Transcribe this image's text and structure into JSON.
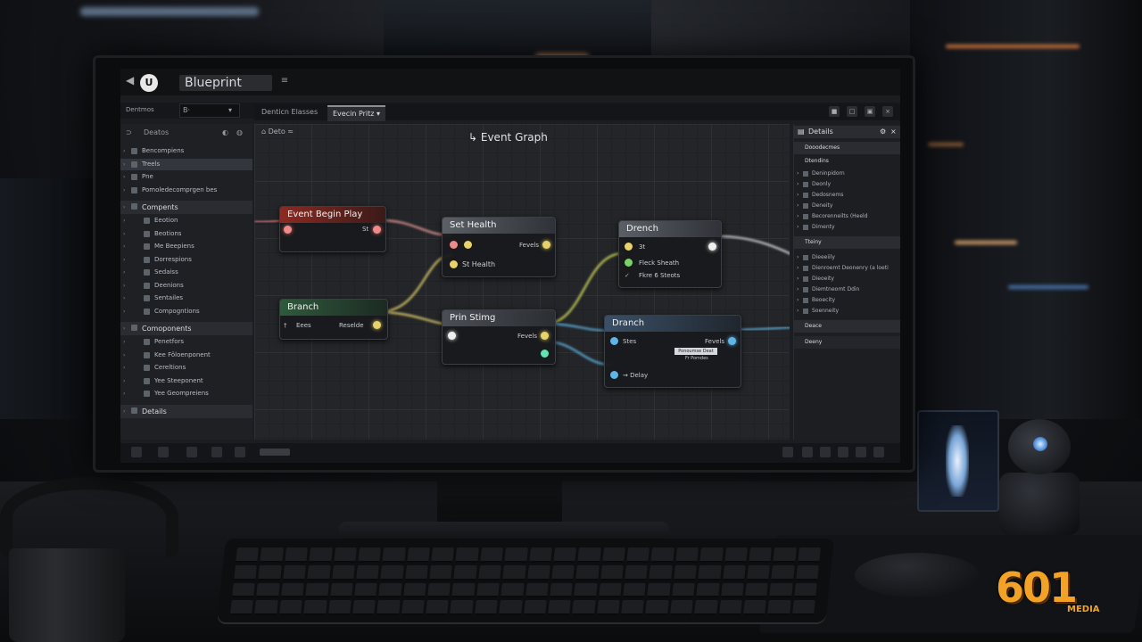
{
  "window": {
    "title": "Blueprint",
    "menu": [
      "Dentmos",
      "B·"
    ],
    "tabs": [
      "Denticn Elasses",
      "Evecin Pritz"
    ],
    "search": "Deatos"
  },
  "left_panel": {
    "sections": [
      {
        "label": "Bencompiens",
        "kind": "row"
      },
      {
        "label": "Treels",
        "kind": "highlight"
      },
      {
        "label": "Pne",
        "kind": "row"
      },
      {
        "label": "Pomoledecomprgen bes",
        "kind": "row"
      },
      {
        "label": "Compents",
        "kind": "header"
      },
      {
        "label": "Eeotion",
        "kind": "sub"
      },
      {
        "label": "Beotions",
        "kind": "sub"
      },
      {
        "label": "Me Beepiens",
        "kind": "sub"
      },
      {
        "label": "Dorrespions",
        "kind": "sub"
      },
      {
        "label": "Sedaiss",
        "kind": "sub"
      },
      {
        "label": "Deenions",
        "kind": "sub"
      },
      {
        "label": "Sentailes",
        "kind": "sub"
      },
      {
        "label": "Compogntions",
        "kind": "sub"
      },
      {
        "label": "Comoponents",
        "kind": "header"
      },
      {
        "label": "Penetfors",
        "kind": "sub"
      },
      {
        "label": "Kee Föloenponent",
        "kind": "sub"
      },
      {
        "label": "Cereltions",
        "kind": "sub"
      },
      {
        "label": "Yee Steeponent",
        "kind": "sub"
      },
      {
        "label": "Yee Geompreiens",
        "kind": "sub"
      },
      {
        "label": "Details",
        "kind": "header"
      }
    ]
  },
  "graph": {
    "title": "Event Graph",
    "crumb": "Deto",
    "nodes": {
      "begin_play": {
        "title": "Event Begin Play",
        "pin": "St"
      },
      "set_health": {
        "title": "Set Health",
        "exec_out": "Fevels",
        "input": "St Health"
      },
      "branch_top": {
        "title": "Drench",
        "input": "3t",
        "p1": "Fleck Sheath",
        "p2": "Fkre 6 Steots"
      },
      "branch_left": {
        "title": "Branch",
        "input": "Eees",
        "output": "Reselde"
      },
      "print_string": {
        "title": "Prin Stimg",
        "output": "Fevels"
      },
      "branch_right": {
        "title": "Dranch",
        "input": "Stes",
        "output": "Fevels",
        "input2": "Delay",
        "inner": "Ponoumse Deat",
        "inner2": "Fr Pomdes"
      }
    }
  },
  "right_panel": {
    "title": "Details",
    "section1": "Dooodecmes",
    "section2": "Dtendins",
    "rows1": [
      "Deninpidorn",
      "Deonly",
      "Dedosnems",
      "Deneity",
      "Becorenneilts (Heeld",
      "Dimenty"
    ],
    "section3": "Tteiny",
    "rows2": [
      "Dieeeiily",
      "Dienroemt Deonenry (a loeti",
      "Dieoeity",
      "Diemtneomt Ddin",
      "Beoecity",
      "Soenneity"
    ],
    "section4": "Deace",
    "section5": "Deeny"
  },
  "brand": {
    "number": "601",
    "name": "MEDIA"
  },
  "colors": {
    "exec_red": "#c0392b",
    "exec_green": "#3f6e4a",
    "wire_yellow": "#e7d36a",
    "wire_blue": "#5fb6e6",
    "logo": "#f2a227"
  }
}
